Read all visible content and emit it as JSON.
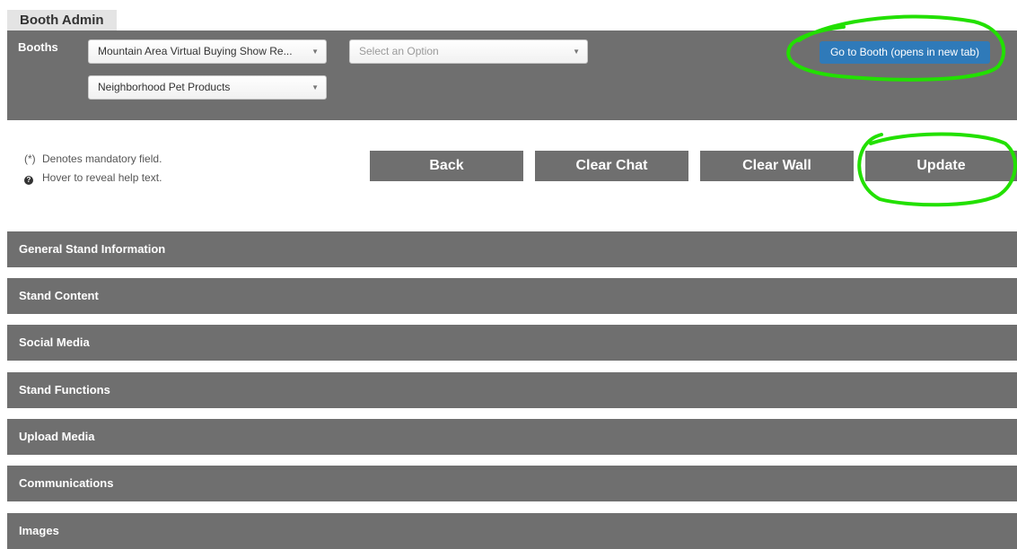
{
  "tab": {
    "title": "Booth Admin"
  },
  "booths": {
    "label": "Booths",
    "event_select": "Mountain Area Virtual Buying Show Re...",
    "option_select": "Select an Option",
    "exhibitor_select": "Neighborhood Pet Products",
    "go_button": "Go to Booth (opens in new tab)"
  },
  "notes": {
    "mandatory_symbol": "(*)",
    "mandatory_text": "Denotes mandatory field.",
    "help_icon_glyph": "?",
    "help_text": "Hover to reveal help text."
  },
  "actions": {
    "back": "Back",
    "clear_chat": "Clear Chat",
    "clear_wall": "Clear Wall",
    "update": "Update"
  },
  "sections": [
    "General Stand Information",
    "Stand Content",
    "Social Media",
    "Stand Functions",
    "Upload Media",
    "Communications",
    "Images"
  ],
  "icons": {
    "caret": "chevron-down-icon",
    "help": "question-circle-icon"
  },
  "colors": {
    "panel": "#6f6f6f",
    "tab": "#e4e4e4",
    "accent": "#2f7ab9",
    "annotation": "#22e000"
  }
}
